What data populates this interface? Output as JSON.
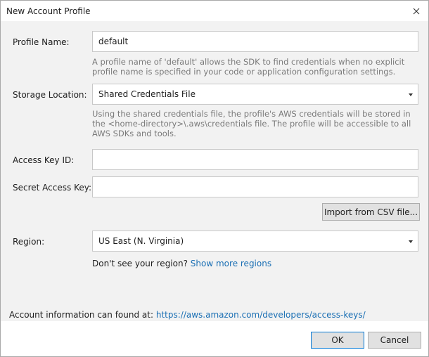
{
  "window": {
    "title": "New Account Profile"
  },
  "profile": {
    "label": "Profile Name:",
    "value": "default",
    "help": "A profile name of 'default' allows the SDK to find credentials when no explicit profile name is specified in your code or application configuration settings."
  },
  "storage": {
    "label": "Storage Location:",
    "selected": "Shared Credentials File",
    "help": "Using the shared credentials file, the profile's AWS credentials will be stored in the <home-directory>\\.aws\\credentials file. The profile will be accessible to all AWS SDKs and tools."
  },
  "access_key": {
    "label": "Access Key ID:",
    "value": ""
  },
  "secret_key": {
    "label": "Secret Access Key:",
    "value": ""
  },
  "import_button": "Import from CSV file...",
  "region": {
    "label": "Region:",
    "selected": "US East (N. Virginia)",
    "hint": "Don't see your region?",
    "more_link": "Show more regions"
  },
  "footer": {
    "text": "Account information can found at:",
    "link": "https://aws.amazon.com/developers/access-keys/"
  },
  "buttons": {
    "ok": "OK",
    "cancel": "Cancel"
  }
}
